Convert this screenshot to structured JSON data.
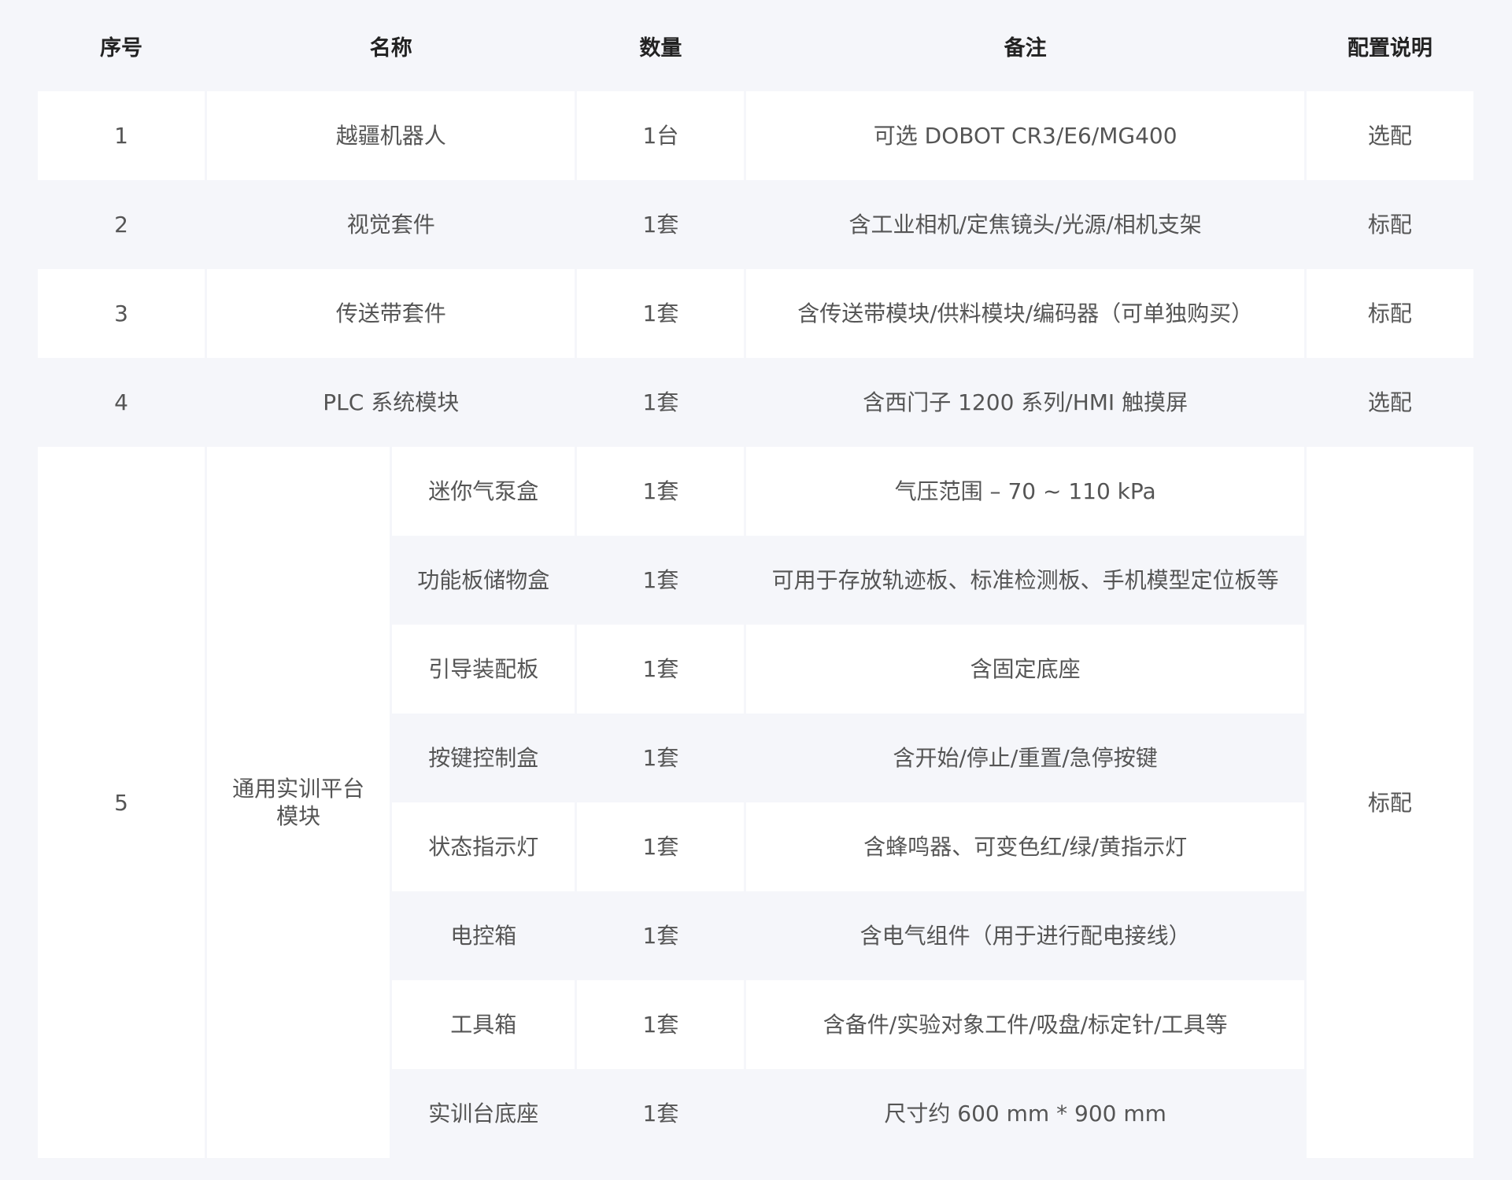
{
  "headers": [
    "序号",
    "名称",
    "数量",
    "备注",
    "配置说明"
  ],
  "rows": [
    {
      "no": "1",
      "name": "越疆机器人",
      "qty": "1台",
      "note": "可选 DOBOT CR3/E6/MG400",
      "config": "选配"
    },
    {
      "no": "2",
      "name": "视觉套件",
      "qty": "1套",
      "note": "含工业相机/定焦镜头/光源/相机支架",
      "config": "标配"
    },
    {
      "no": "3",
      "name": "传送带套件",
      "qty": "1套",
      "note": "含传送带模块/供料模块/编码器（可单独购买）",
      "config": "标配"
    },
    {
      "no": "4",
      "name": "PLC 系统模块",
      "qty": "1套",
      "note": "含西门子 1200 系列/HMI 触摸屏",
      "config": "选配"
    }
  ],
  "group": {
    "no": "5",
    "name_line1": "通用实训平台",
    "name_line2": "模块",
    "config": "标配",
    "items": [
      {
        "name": "迷你气泵盒",
        "qty": "1套",
        "note": "气压范围 – 70 ~ 110 kPa"
      },
      {
        "name": "功能板储物盒",
        "qty": "1套",
        "note": "可用于存放轨迹板、标准检测板、手机模型定位板等"
      },
      {
        "name": "引导装配板",
        "qty": "1套",
        "note": "含固定底座"
      },
      {
        "name": "按键控制盒",
        "qty": "1套",
        "note": "含开始/停止/重置/急停按键"
      },
      {
        "name": "状态指示灯",
        "qty": "1套",
        "note": "含蜂鸣器、可变色红/绿/黄指示灯"
      },
      {
        "name": "电控箱",
        "qty": "1套",
        "note": "含电气组件（用于进行配电接线）"
      },
      {
        "name": "工具箱",
        "qty": "1套",
        "note": "含备件/实验对象工件/吸盘/标定针/工具等"
      },
      {
        "name": "实训台底座",
        "qty": "1套",
        "note": "尺寸约 600 mm * 900 mm"
      }
    ]
  }
}
